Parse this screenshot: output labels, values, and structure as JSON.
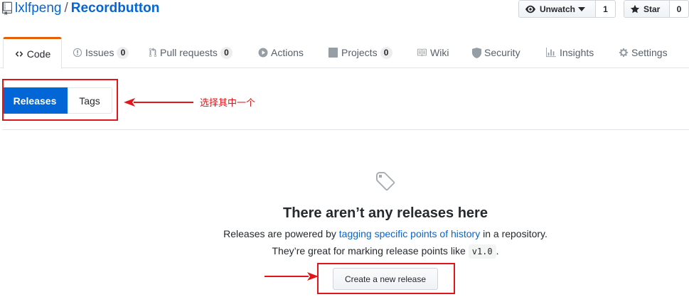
{
  "repo": {
    "owner": "lxlfpeng",
    "separator": "/",
    "name": "Recordbutton"
  },
  "watch": {
    "label": "Unwatch",
    "count": "1"
  },
  "star": {
    "label": "Star",
    "count": "0"
  },
  "tabs": [
    {
      "label": "Code",
      "icon": "code-icon"
    },
    {
      "label": "Issues",
      "icon": "issue-icon",
      "count": "0"
    },
    {
      "label": "Pull requests",
      "icon": "pull-request-icon",
      "count": "0"
    },
    {
      "label": "Actions",
      "icon": "play-icon"
    },
    {
      "label": "Projects",
      "icon": "project-icon",
      "count": "0"
    },
    {
      "label": "Wiki",
      "icon": "book-icon"
    },
    {
      "label": "Security",
      "icon": "shield-icon"
    },
    {
      "label": "Insights",
      "icon": "graph-icon"
    },
    {
      "label": "Settings",
      "icon": "gear-icon"
    }
  ],
  "segment": {
    "releases": "Releases",
    "tags": "Tags"
  },
  "annotation": {
    "note": "选择其中一个",
    "color": "#e0161a"
  },
  "blankslate": {
    "title": "There aren’t any releases here",
    "line1_prefix": "Releases are powered by ",
    "line1_link": "tagging specific points of history",
    "line1_suffix": " in a repository.",
    "line2_prefix": "They’re great for marking release points like ",
    "line2_code": "v1.0",
    "line2_suffix": "."
  },
  "create_button": "Create a new release",
  "colors": {
    "link": "#0366d6",
    "primary": "#0366d6",
    "active_tab": "#e36209"
  }
}
